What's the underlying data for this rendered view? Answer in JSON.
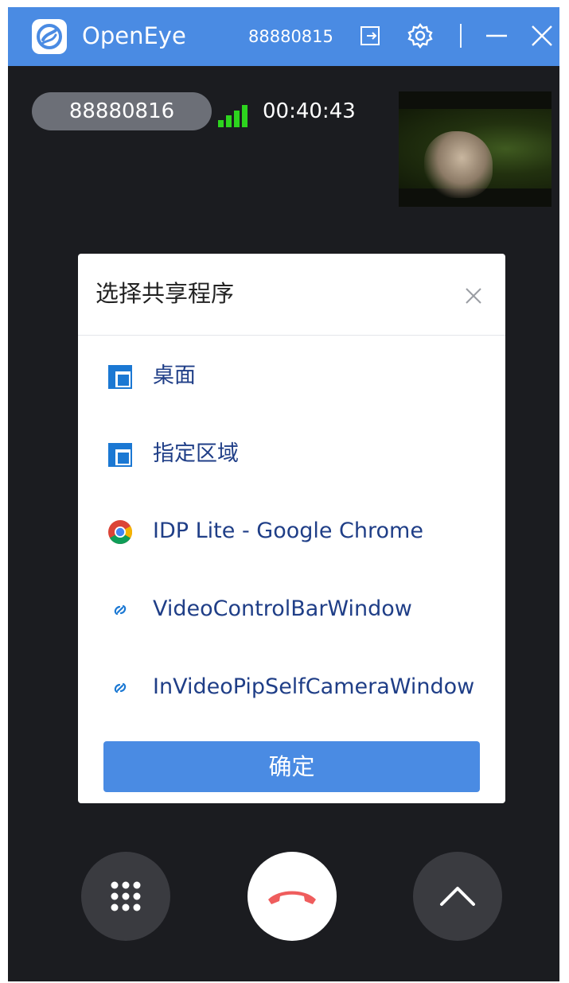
{
  "titlebar": {
    "app_name": "OpenEye",
    "user_id": "88880815"
  },
  "call": {
    "remote_id": "88880816",
    "duration": "00:40:43",
    "signal_level": 4,
    "signal_max": 4
  },
  "share_dialog": {
    "title": "选择共享程序",
    "options": [
      {
        "label": "桌面",
        "icon": "screen-icon"
      },
      {
        "label": "指定区域",
        "icon": "region-icon"
      },
      {
        "label": "IDP Lite - Google Chrome",
        "icon": "chrome-icon"
      },
      {
        "label": "VideoControlBarWindow",
        "icon": "app-link-icon"
      },
      {
        "label": "InVideoPipSelfCameraWindow",
        "icon": "app-link-icon"
      }
    ],
    "confirm_label": "确定"
  },
  "colors": {
    "accent": "#4a8be3",
    "background": "#1b1c20",
    "signal": "#2dd41e",
    "hangup": "#ef5d5d",
    "option_text": "#1f3e87"
  }
}
